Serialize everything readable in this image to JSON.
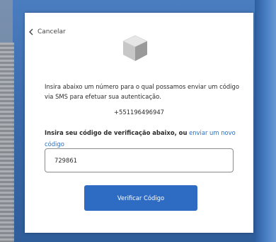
{
  "nav": {
    "back_label": "Cancelar",
    "back_icon": "chevron-left-icon"
  },
  "illustration": {
    "icon": "cube-icon"
  },
  "content": {
    "description": "Insira abaixo um número para o qual possamos enviar um código via SMS para efetuar sua autenticação.",
    "phone_number": "+551196496947",
    "prompt_bold": "Insira seu código de verificação abaixo, ou",
    "resend_link": "enviar um novo código"
  },
  "form": {
    "code_value": "729861",
    "submit_label": "Verificar Código"
  },
  "colors": {
    "primary_button": "#2e6cc3",
    "link": "#2a6ebd",
    "background": "#3f6fae"
  }
}
